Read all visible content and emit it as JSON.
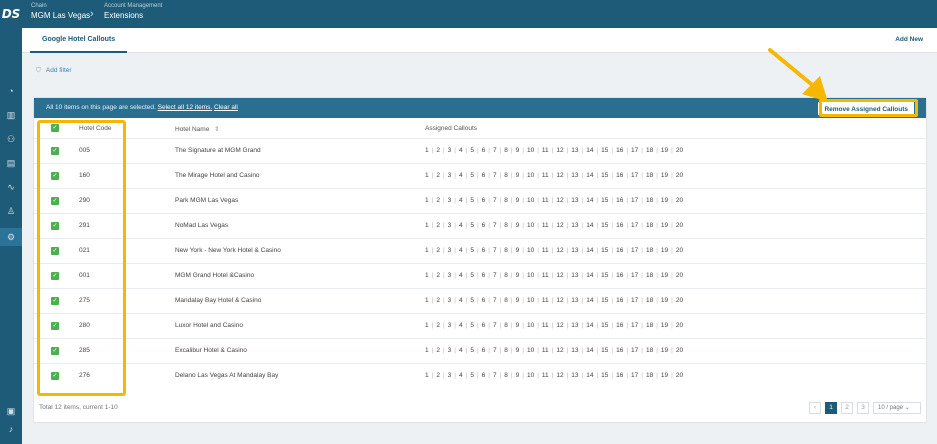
{
  "app": {
    "logo": "DS"
  },
  "breadcrumb": [
    {
      "label": "Chain",
      "value": "MGM Las Vegas"
    },
    {
      "label": "Account Management",
      "value": "Extensions"
    }
  ],
  "tab": {
    "label": "Google Hotel Callouts"
  },
  "add_new": "Add New",
  "filter": {
    "label": "Add filter"
  },
  "selection": {
    "text": "All 10 items on this page are selected.",
    "select_all": "Select all 12 items.",
    "clear_all": "Clear all",
    "remove_button": "Remove Assigned Callouts"
  },
  "columns": {
    "code": "Hotel Code",
    "name": "Hotel Name",
    "callouts": "Assigned Callouts"
  },
  "callout_numbers": [
    "1",
    "2",
    "3",
    "4",
    "5",
    "6",
    "7",
    "8",
    "9",
    "10",
    "11",
    "12",
    "13",
    "14",
    "15",
    "16",
    "17",
    "18",
    "19",
    "20"
  ],
  "rows": [
    {
      "code": "005",
      "name": "The Signature at MGM Grand"
    },
    {
      "code": "160",
      "name": "The Mirage Hotel and Casino"
    },
    {
      "code": "290",
      "name": "Park MGM Las Vegas"
    },
    {
      "code": "291",
      "name": "NoMad Las Vegas"
    },
    {
      "code": "021",
      "name": "New York - New York Hotel & Casino"
    },
    {
      "code": "001",
      "name": "MGM Grand Hotel &Casino"
    },
    {
      "code": "275",
      "name": "Mandalay Bay Hotel & Casino"
    },
    {
      "code": "280",
      "name": "Luxor Hotel and Casino"
    },
    {
      "code": "285",
      "name": "Excalibur Hotel & Casino"
    },
    {
      "code": "276",
      "name": "Delano Las Vegas At Mandalay Bay"
    }
  ],
  "footer": {
    "total": "Total 12 items, current 1-10",
    "pages": [
      "1",
      "2",
      "3"
    ],
    "page_size": "10 / page"
  },
  "colors": {
    "brand": "#1d5b78",
    "highlight": "#f5b700",
    "check": "#4caf50"
  }
}
